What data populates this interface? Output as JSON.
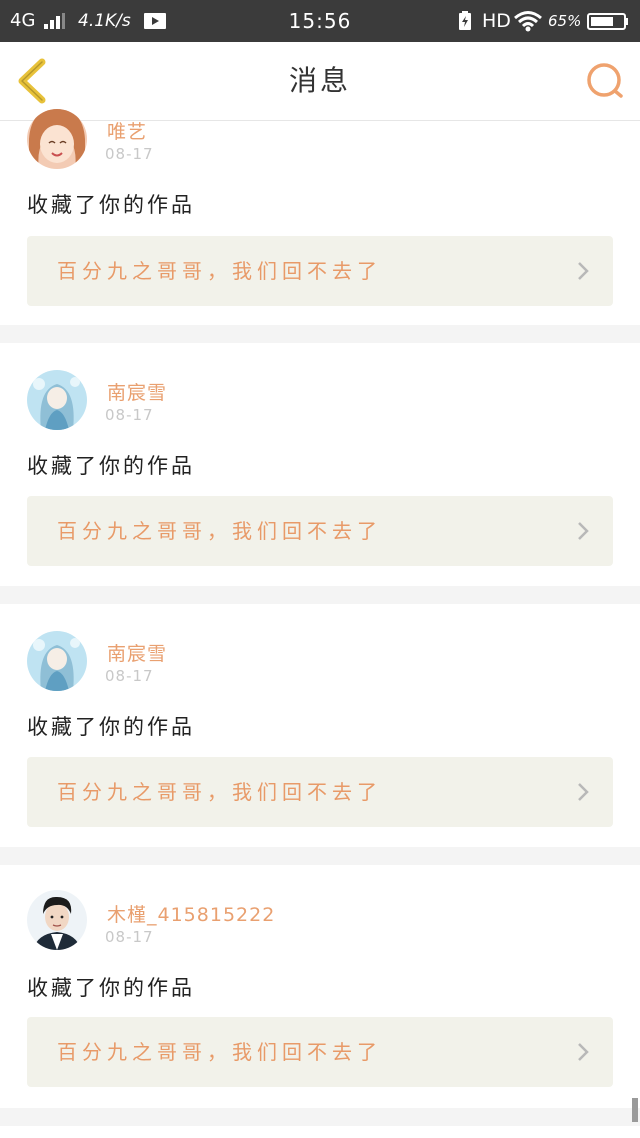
{
  "status_bar": {
    "network": "4G",
    "speed": "4.1K/s",
    "time": "15:56",
    "hd": "HD",
    "battery_pct": "65%"
  },
  "header": {
    "title": "消息",
    "back_icon": "chevron-left-icon",
    "search_icon": "search-icon"
  },
  "colors": {
    "accent": "#e9a070",
    "back_icon": "#e8c23a",
    "work_bg": "#f2f2ea"
  },
  "messages": [
    {
      "user": "唯艺",
      "date": "08-17",
      "action": "收藏了你的作品",
      "work_title": "百分九之哥哥，我们回不去了"
    },
    {
      "user": "南宸雪",
      "date": "08-17",
      "action": "收藏了你的作品",
      "work_title": "百分九之哥哥，我们回不去了"
    },
    {
      "user": "南宸雪",
      "date": "08-17",
      "action": "收藏了你的作品",
      "work_title": "百分九之哥哥，我们回不去了"
    },
    {
      "user": "木槿_415815222",
      "date": "08-17",
      "action": "收藏了你的作品",
      "work_title": "百分九之哥哥，我们回不去了"
    }
  ]
}
